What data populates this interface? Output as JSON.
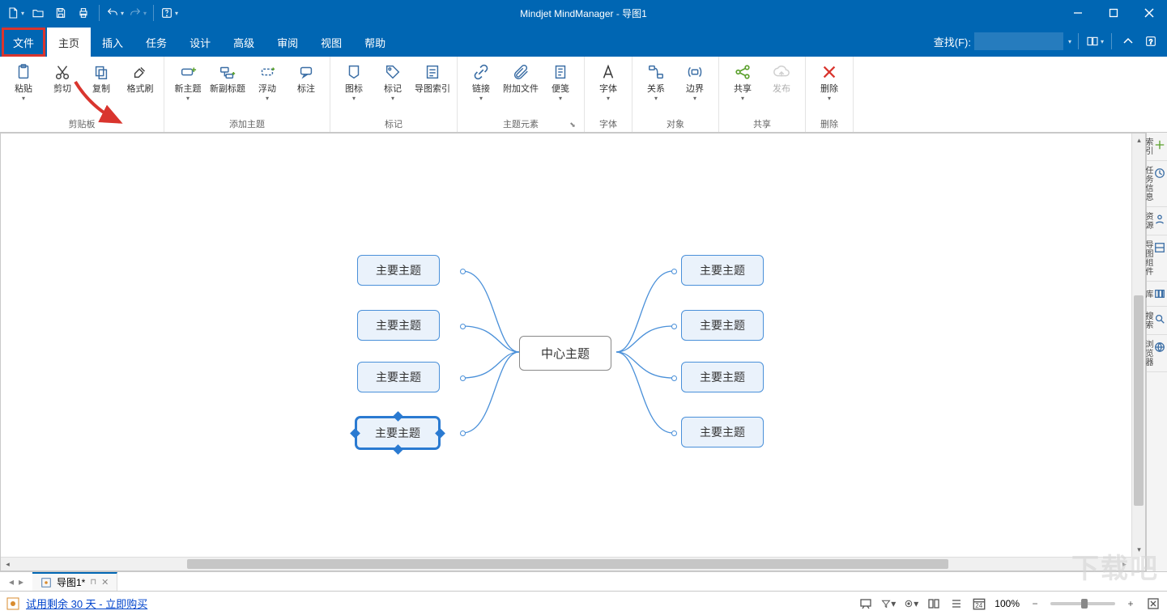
{
  "app": {
    "title": "Mindjet MindManager - 导图1"
  },
  "menu": {
    "tabs": [
      "文件",
      "主页",
      "插入",
      "任务",
      "设计",
      "高级",
      "审阅",
      "视图",
      "帮助"
    ],
    "active_index": 1,
    "find_label": "查找(F):"
  },
  "ribbon": {
    "clipboard": {
      "label": "剪贴板",
      "paste": "粘贴",
      "cut": "剪切",
      "copy": "复制",
      "format_painter": "格式刷"
    },
    "add_topic": {
      "label": "添加主题",
      "new_topic": "新主题",
      "new_subtopic": "新副标题",
      "floating": "浮动",
      "callout": "标注"
    },
    "markers": {
      "label": "标记",
      "icon": "图标",
      "tag": "标记",
      "map_index": "导图索引"
    },
    "topic_elements": {
      "label": "主题元素",
      "link": "链接",
      "attachment": "附加文件",
      "note": "便笺"
    },
    "font": {
      "label": "字体",
      "font_btn": "字体"
    },
    "objects": {
      "label": "对象",
      "relationship": "关系",
      "boundary": "边界"
    },
    "share": {
      "label": "共享",
      "share_btn": "共享",
      "publish": "发布"
    },
    "delete": {
      "label": "删除",
      "delete_btn": "删除"
    }
  },
  "mindmap": {
    "center": "中心主题",
    "left": [
      "主要主题",
      "主要主题",
      "主要主题",
      "主要主题"
    ],
    "right": [
      "主要主题",
      "主要主题",
      "主要主题",
      "主要主题"
    ],
    "selected_left_index": 3
  },
  "right_rail": [
    "索引",
    "任务信息",
    "资源",
    "导图组件",
    "库",
    "搜索",
    "浏览器"
  ],
  "doc_tab": {
    "name": "导图1*"
  },
  "statusbar": {
    "trial": "试用剩余 30 天 - 立即购买",
    "zoom": "100%",
    "date_badge": "24"
  },
  "watermark": "下载吧"
}
